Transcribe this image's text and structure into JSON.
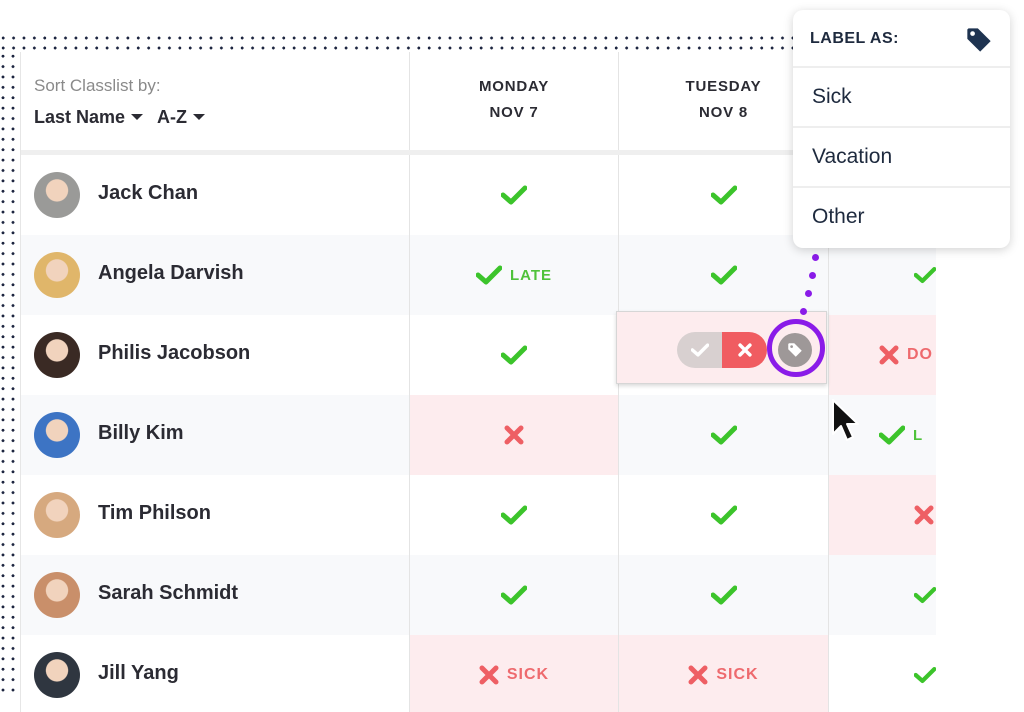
{
  "sort": {
    "label": "Sort Classlist by:",
    "field": "Last Name",
    "order": "A-Z"
  },
  "columns": [
    {
      "day": "MONDAY",
      "date": "NOV 7"
    },
    {
      "day": "TUESDAY",
      "date": "NOV 8"
    },
    {
      "day": "",
      "date": ""
    }
  ],
  "students": [
    {
      "name": "Jack Chan",
      "avatar_color": "#9a9a98",
      "attendance": [
        {
          "status": "present",
          "label": ""
        },
        {
          "status": "present",
          "label": ""
        },
        {
          "status": "present",
          "label": ""
        }
      ]
    },
    {
      "name": "Angela Darvish",
      "avatar_color": "#e0b66a",
      "attendance": [
        {
          "status": "present",
          "label": "LATE"
        },
        {
          "status": "present",
          "label": ""
        },
        {
          "status": "present",
          "label": ""
        }
      ]
    },
    {
      "name": "Philis Jacobson",
      "avatar_color": "#3a2a24",
      "attendance": [
        {
          "status": "present",
          "label": ""
        },
        {
          "status": "editing",
          "label": ""
        },
        {
          "status": "absent",
          "label": "DO"
        }
      ]
    },
    {
      "name": "Billy Kim",
      "avatar_color": "#3d74c4",
      "attendance": [
        {
          "status": "absent",
          "label": ""
        },
        {
          "status": "present",
          "label": ""
        },
        {
          "status": "present",
          "label": "L"
        }
      ]
    },
    {
      "name": "Tim Philson",
      "avatar_color": "#d6a97f",
      "attendance": [
        {
          "status": "present",
          "label": ""
        },
        {
          "status": "present",
          "label": ""
        },
        {
          "status": "absent",
          "label": ""
        }
      ]
    },
    {
      "name": "Sarah Schmidt",
      "avatar_color": "#c98f6a",
      "attendance": [
        {
          "status": "present",
          "label": ""
        },
        {
          "status": "present",
          "label": ""
        },
        {
          "status": "present",
          "label": ""
        }
      ]
    },
    {
      "name": "Jill Yang",
      "avatar_color": "#2f3640",
      "attendance": [
        {
          "status": "absent",
          "label": "SICK"
        },
        {
          "status": "absent",
          "label": "SICK"
        },
        {
          "status": "present",
          "label": ""
        }
      ]
    }
  ],
  "popup": {
    "title": "LABEL AS:",
    "icon": "tag-icon",
    "options": [
      "Sick",
      "Vacation",
      "Other"
    ]
  },
  "colors": {
    "present": "#3cc42b",
    "absent": "#ee5f64",
    "absent_bg": "#fdecee",
    "highlight": "#8a1be8",
    "text_dark": "#1e2a3e"
  }
}
